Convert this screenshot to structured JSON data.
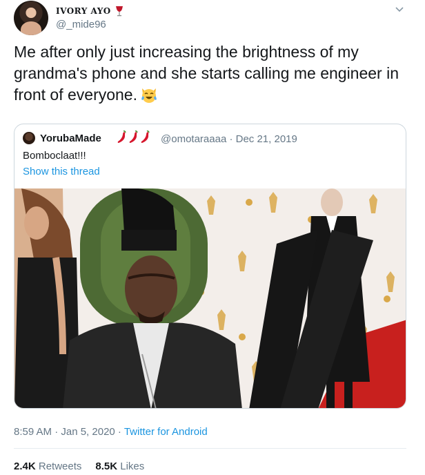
{
  "author": {
    "display_name": "IVORY AYO",
    "handle": "@_mide96",
    "badge_icon": "wine-glass-icon"
  },
  "tweet": {
    "text": "Me after only just increasing the brightness of my grandma's phone and she starts calling me engineer in front of everyone.",
    "emoji": "tears-of-joy-cat-emoji"
  },
  "quoted": {
    "display_name": "YorubaMade",
    "name_emojis": [
      "chili-pepper-icon",
      "chili-pepper-icon",
      "chili-pepper-icon"
    ],
    "handle_date": "@omotaraaaa · Dec 21, 2019",
    "text": "Bomboclaat!!!",
    "thread_link": "Show this thread",
    "image_subject": "photo"
  },
  "meta": {
    "time_date": "8:59 AM · Jan 5, 2020 · ",
    "source": "Twitter for Android"
  },
  "stats": {
    "retweets_count": "2.4K",
    "retweets_label": "Retweets",
    "likes_count": "8.5K",
    "likes_label": "Likes"
  },
  "colors": {
    "link": "#1b95e0",
    "secondary": "#657786",
    "border": "#ccd6dd"
  }
}
